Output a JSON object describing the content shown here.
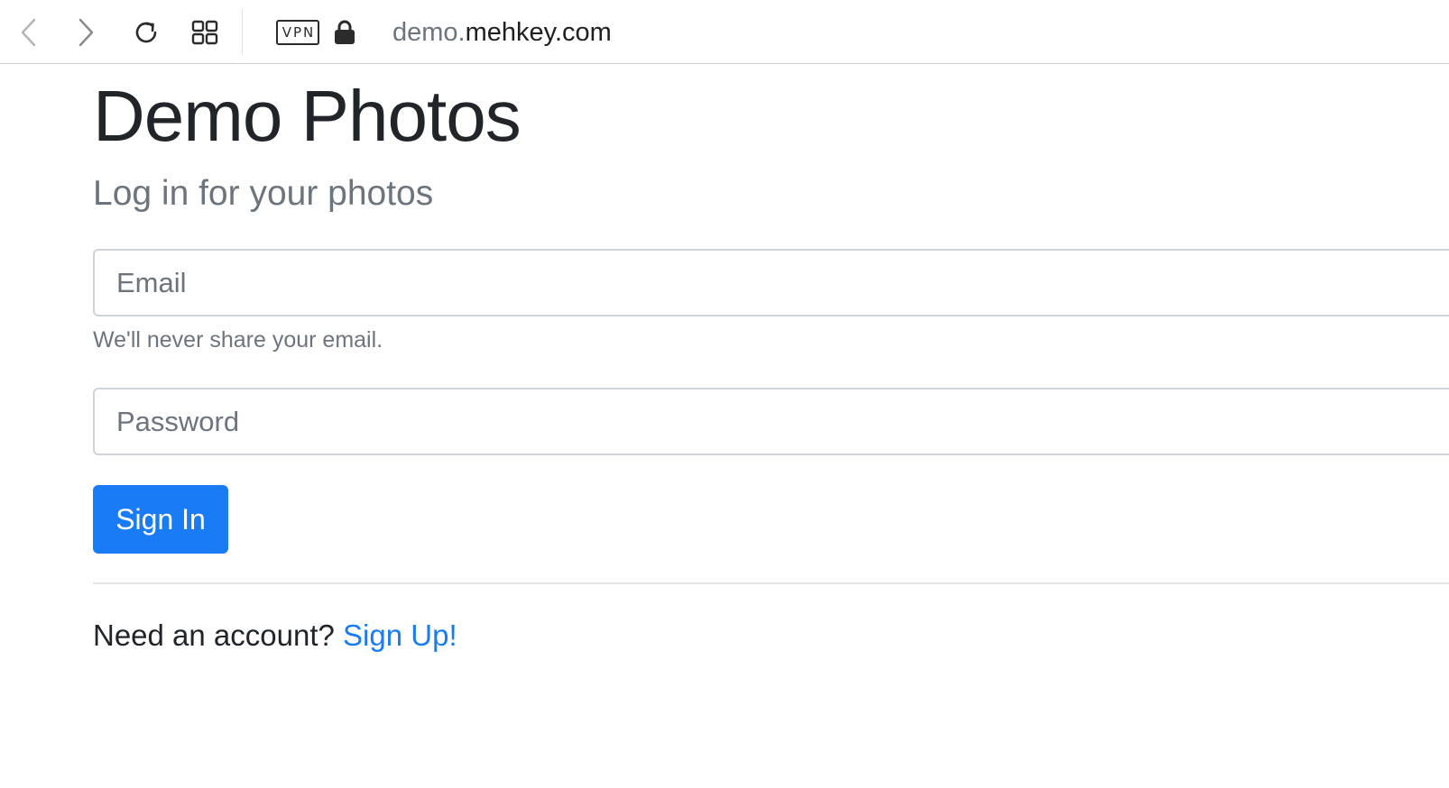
{
  "browser": {
    "url_subdomain": "demo.",
    "url_domain": "mehkey.com",
    "vpn_label": "VPN",
    "icons": {
      "back": "chevron-left-icon",
      "forward": "chevron-right-icon",
      "reload": "reload-icon",
      "tabs": "tab-overview-icon",
      "lock": "lock-icon"
    }
  },
  "page": {
    "title": "Demo Photos",
    "subtitle": "Log in for your photos"
  },
  "form": {
    "email_placeholder": "Email",
    "email_value": "",
    "email_help": "We'll never share your email.",
    "password_placeholder": "Password",
    "password_value": "",
    "signin_label": "Sign In"
  },
  "footer": {
    "prompt": "Need an account?",
    "signup_label": "Sign Up!"
  },
  "colors": {
    "primary": "#1a7cf5",
    "text": "#212529",
    "muted": "#6c757d",
    "border": "#ced4da"
  }
}
